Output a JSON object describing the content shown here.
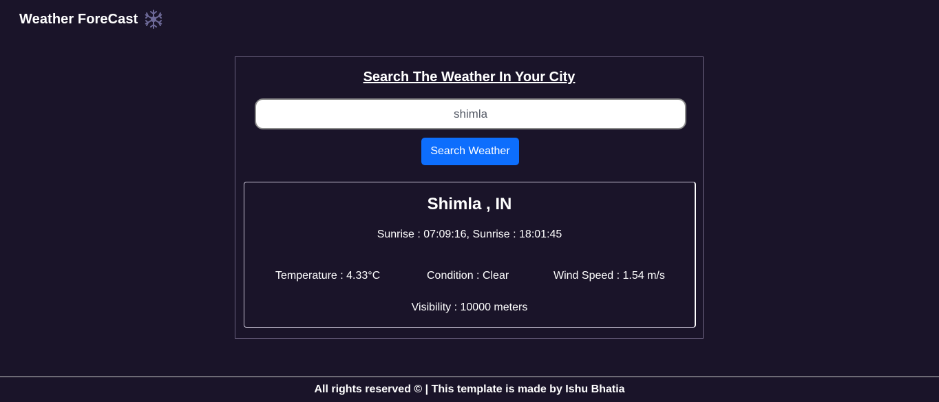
{
  "navbar": {
    "brand": "Weather ForeCast",
    "brand_icon": "snowflake-icon"
  },
  "search": {
    "title": "Search The Weather In Your City",
    "value": "shimla",
    "button_label": "Search Weather"
  },
  "result": {
    "city": "Shimla , IN",
    "sun_times": "Sunrise : 07:09:16, Sunrise : 18:01:45",
    "temperature": "Temperature : 4.33°C",
    "condition": "Condition : Clear",
    "wind_speed": "Wind Speed : 1.54 m/s",
    "visibility": "Visibility : 10000 meters"
  },
  "footer": {
    "text": "All rights reserved © | This template is made by Ishu Bhatia"
  },
  "colors": {
    "background": "#1a1429",
    "button": "#0d6efd",
    "icon": "#6e6a99"
  }
}
